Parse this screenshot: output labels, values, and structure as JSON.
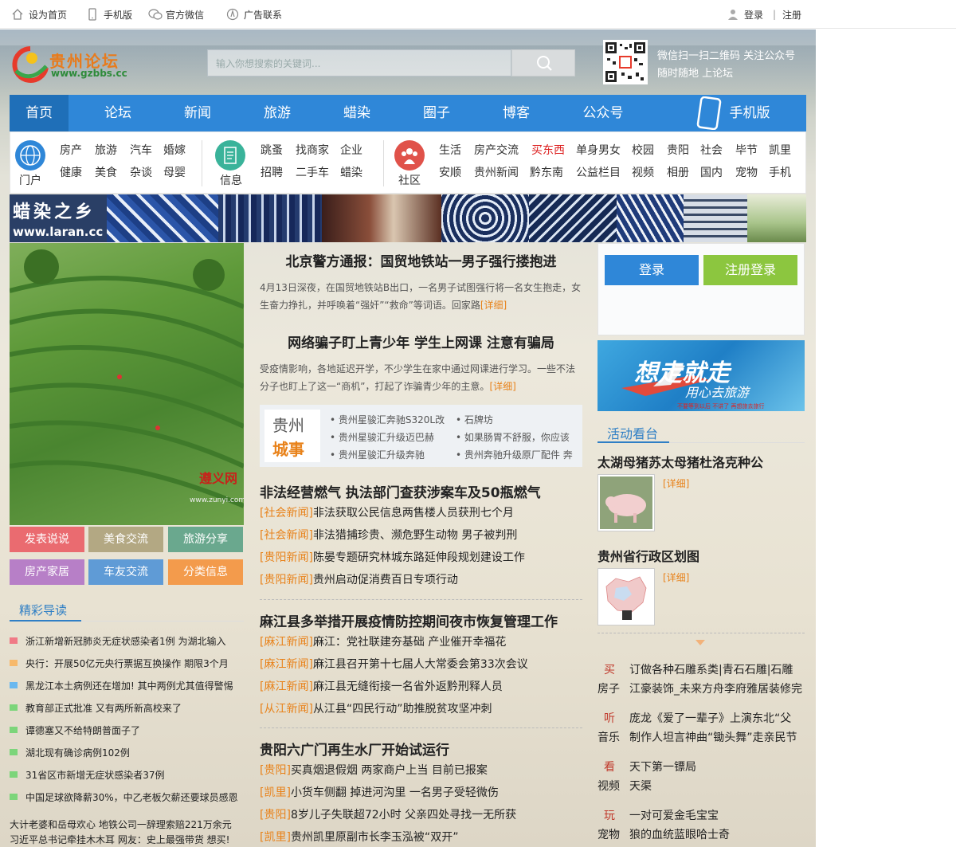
{
  "topbar": {
    "items": [
      "设为首页",
      "手机版",
      "官方微信",
      "广告联系"
    ],
    "login": "登录",
    "register": "注册"
  },
  "header": {
    "logo_cn": "贵州论坛",
    "logo_url": "www.gzbbs.cc",
    "search_placeholder": "输入你想搜索的关键词...",
    "qr_line1": "微信扫一扫二维码  关注公众号",
    "qr_line2": "随时随地  上论坛"
  },
  "nav": {
    "items": [
      "首页",
      "论坛",
      "新闻",
      "旅游",
      "蜡染",
      "圈子",
      "博客",
      "公众号",
      "手机版"
    ]
  },
  "subnav": {
    "groups": [
      {
        "label": "门户",
        "links": [
          "房产",
          "旅游",
          "汽车",
          "婚嫁",
          "健康",
          "美食",
          "杂谈",
          "母婴"
        ]
      },
      {
        "label": "信息",
        "links": [
          "跳蚤",
          "找商家",
          "企业",
          "招聘",
          "二手车",
          "蜡染"
        ]
      },
      {
        "label": "社区",
        "links": [
          "生活",
          "房产交流",
          "买东西",
          "单身男女",
          "校园",
          "贵阳",
          "社会",
          "毕节",
          "凯里",
          "安顺",
          "贵州新闻",
          "黔东南",
          "公益栏目",
          "视频",
          "相册",
          "国内",
          "宠物",
          "手机"
        ]
      }
    ]
  },
  "banner": {
    "title": "蜡染之乡",
    "url": "www.laran.cc"
  },
  "photo": {
    "brand": "遵义网",
    "brand_url": "www.zunyi.com"
  },
  "tiles": [
    "发表说说",
    "美食交流",
    "旅游分享",
    "房产家居",
    "车友交流",
    "分类信息"
  ],
  "picks": {
    "title": "精彩导读",
    "items": [
      "浙江新增新冠肺炎无症状感染者1例 为湖北输入",
      "央行：开展50亿元央行票据互换操作 期限3个月",
      "黑龙江本土病例还在增加! 其中两例尤其值得警惕",
      "教育部正式批准 又有两所新高校来了",
      "谭德塞又不给特朗普面子了",
      "湖北现有确诊病例102例",
      "31省区市新增无症状感染者37例",
      "中国足球欲降薪30%，中乙老板欠薪还要球员感恩",
      "大计老婆和岳母欢心 地铁公司一辞理索赔221万余元",
      "习近平总书记牵挂木木耳 网友：史上最强带货 想买!"
    ]
  },
  "headlines": [
    {
      "title": "北京警方通报：国贸地铁站一男子强行搂抱进",
      "text": "4月13日深夜，在国贸地铁站B出口，一名男子试图强行将一名女生抱走，女生奋力挣扎，并呼唤着“强奸”“救命”等词语。回家路",
      "more": "[详细]"
    },
    {
      "title": "网络骗子盯上青少年 学生上网课 注意有骗局",
      "text": "受疫情影响，各地延迟开学，不少学生在家中通过网课进行学习。一些不法分子也盯上了这一“商机”，打起了诈骗青少年的主意。",
      "more": "[详细]"
    }
  ],
  "city": {
    "label1": "贵州",
    "label2": "城事",
    "items": [
      "贵州星骏汇奔驰S320L改",
      "石牌坊",
      "贵州星骏汇升级迈巴赫",
      "如果肠胃不舒服，你应该",
      "贵州星骏汇升级奔驰",
      "贵州奔驰升级原厂配件 奔"
    ]
  },
  "sections": [
    {
      "title": "非法经营燃气 执法部门查获涉案车及50瓶燃气",
      "rows": [
        {
          "tag": "[社会新闻]",
          "text": "非法获取公民信息两售楼人员获刑七个月"
        },
        {
          "tag": "[社会新闻]",
          "text": "非法猎捕珍贵、濒危野生动物 男子被判刑"
        },
        {
          "tag": "[贵阳新闻]",
          "text": "陈晏专题研究林城东路延伸段规划建设工作"
        },
        {
          "tag": "[贵阳新闻]",
          "text": "贵州启动促消费百日专项行动"
        }
      ]
    },
    {
      "title": "麻江县多举措开展疫情防控期间夜市恢复管理工作",
      "rows": [
        {
          "tag": "[麻江新闻]",
          "text": "麻江：党社联建夯基础 产业催开幸福花"
        },
        {
          "tag": "[麻江新闻]",
          "text": "麻江县召开第十七届人大常委会第33次会议"
        },
        {
          "tag": "[麻江新闻]",
          "text": "麻江县无缝衔接一名省外返黔刑释人员"
        },
        {
          "tag": "[从江新闻]",
          "text": "从江县“四民行动”助推脱贫攻坚冲刺"
        }
      ]
    },
    {
      "title": "贵阳六广门再生水厂开始试运行",
      "rows": [
        {
          "tag": "[贵阳]",
          "text": "买真烟退假烟 两家商户上当 目前已报案"
        },
        {
          "tag": "[凯里]",
          "text": "小货车侧翻 掉进河沟里 一名男子受轻微伤"
        },
        {
          "tag": "[贵阳]",
          "text": "8岁儿子失联超72小时 父亲四处寻找一无所获"
        },
        {
          "tag": "[凯里]",
          "text": "贵州凯里原副市长李玉泓被“双开”"
        }
      ]
    }
  ],
  "right": {
    "login_btn": "登录",
    "register_btn": "注册登录",
    "travel_big": "想走就走",
    "travel_sub": "用心去旅游",
    "travel_small": "不要等到以后 不讲了 再想旅去旅行",
    "activity_title": "活动看台",
    "act1_title": "太湖母猪苏太母猪杜洛克种公",
    "act1_more": "[详细]",
    "act2_title": "贵州省行政区划图",
    "act2_more": "[详细]",
    "lists": [
      {
        "k1": "买",
        "k2": "房子",
        "l1": "订做各种石雕系类|青石石雕|石雕",
        "l2": "江豪装饰_未来方舟李府雅居装修完"
      },
      {
        "k1": "听",
        "k2": "音乐",
        "l1": "庞龙《爱了一辈子》上演东北“父",
        "l2": "制作人坦言神曲“锄头舞”走亲民节"
      },
      {
        "k1": "看",
        "k2": "视频",
        "l1": "天下第一镖局",
        "l2": "天渠"
      },
      {
        "k1": "玩",
        "k2": "宠物",
        "l1": "一对可爱金毛宝宝",
        "l2": "狼的血统蓝眼哈士奇"
      }
    ]
  },
  "colors": {
    "nav": "#2f87d8",
    "nav_active": "#1f6fb8",
    "accent_orange": "#e8821a",
    "login_btn": "#2f87d8",
    "register_btn": "#8cc63f"
  }
}
